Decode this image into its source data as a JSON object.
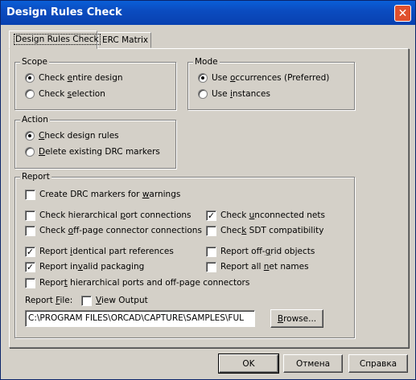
{
  "window": {
    "title": "Design Rules Check",
    "close_glyph": "✕"
  },
  "tabs": [
    {
      "label": "Design Rules Check",
      "active": true
    },
    {
      "label": "ERC Matrix",
      "active": false
    }
  ],
  "scope": {
    "label": "Scope",
    "options": [
      {
        "pre": "Check ",
        "key": "e",
        "post": "ntire design",
        "selected": true
      },
      {
        "pre": "Check ",
        "key": "s",
        "post": "election",
        "selected": false
      }
    ]
  },
  "mode": {
    "label": "Mode",
    "options": [
      {
        "pre": "Use ",
        "key": "o",
        "post": "ccurrences (Preferred)",
        "selected": true
      },
      {
        "pre": "Use ",
        "key": "i",
        "post": "nstances",
        "selected": false
      }
    ]
  },
  "action": {
    "label": "Action",
    "options": [
      {
        "pre": "",
        "key": "C",
        "post": "heck design rules",
        "selected": true
      },
      {
        "pre": "",
        "key": "D",
        "post": "elete existing DRC markers",
        "selected": false
      }
    ]
  },
  "report": {
    "label": "Report",
    "checks": {
      "create_drc_markers": {
        "pre": "Create DRC markers for ",
        "key": "w",
        "post": "arnings",
        "checked": false
      },
      "hier_port": {
        "pre": "Check hierarchical ",
        "key": "p",
        "post": "ort connections",
        "checked": false
      },
      "offpage": {
        "pre": "Check ",
        "key": "o",
        "post": "ff-page connector connections",
        "checked": false
      },
      "identical_part": {
        "pre": "Report ",
        "key": "i",
        "post": "dentical part references",
        "checked": true
      },
      "invalid_packaging": {
        "pre": "Report in",
        "key": "v",
        "post": "alid packaging",
        "checked": true
      },
      "hier_ports_offpage": {
        "pre": "Repor",
        "key": "t",
        "post": " hierarchical ports and off-page connectors",
        "checked": false
      },
      "unconnected_nets": {
        "pre": "Check ",
        "key": "u",
        "post": "nconnected nets",
        "checked": true
      },
      "sdt_compat": {
        "pre": "Chec",
        "key": "k",
        "post": " SDT compatibility",
        "checked": false
      },
      "offgrid": {
        "pre": "Report off-",
        "key": "g",
        "post": "rid objects",
        "checked": false
      },
      "all_net_names": {
        "pre": "Report all ",
        "key": "n",
        "post": "et names",
        "checked": false
      }
    },
    "file_label": {
      "pre": "Report ",
      "key": "F",
      "post": "ile:"
    },
    "view_output": {
      "pre": "",
      "key": "V",
      "post": "iew Output",
      "checked": false
    },
    "file_path": "C:\\PROGRAM FILES\\ORCAD\\CAPTURE\\SAMPLES\\FUL",
    "browse": {
      "pre": "",
      "key": "B",
      "post": "rowse..."
    }
  },
  "buttons": {
    "ok": "OK",
    "cancel": "Отмена",
    "help": "Справка"
  },
  "check_glyph": "✓"
}
